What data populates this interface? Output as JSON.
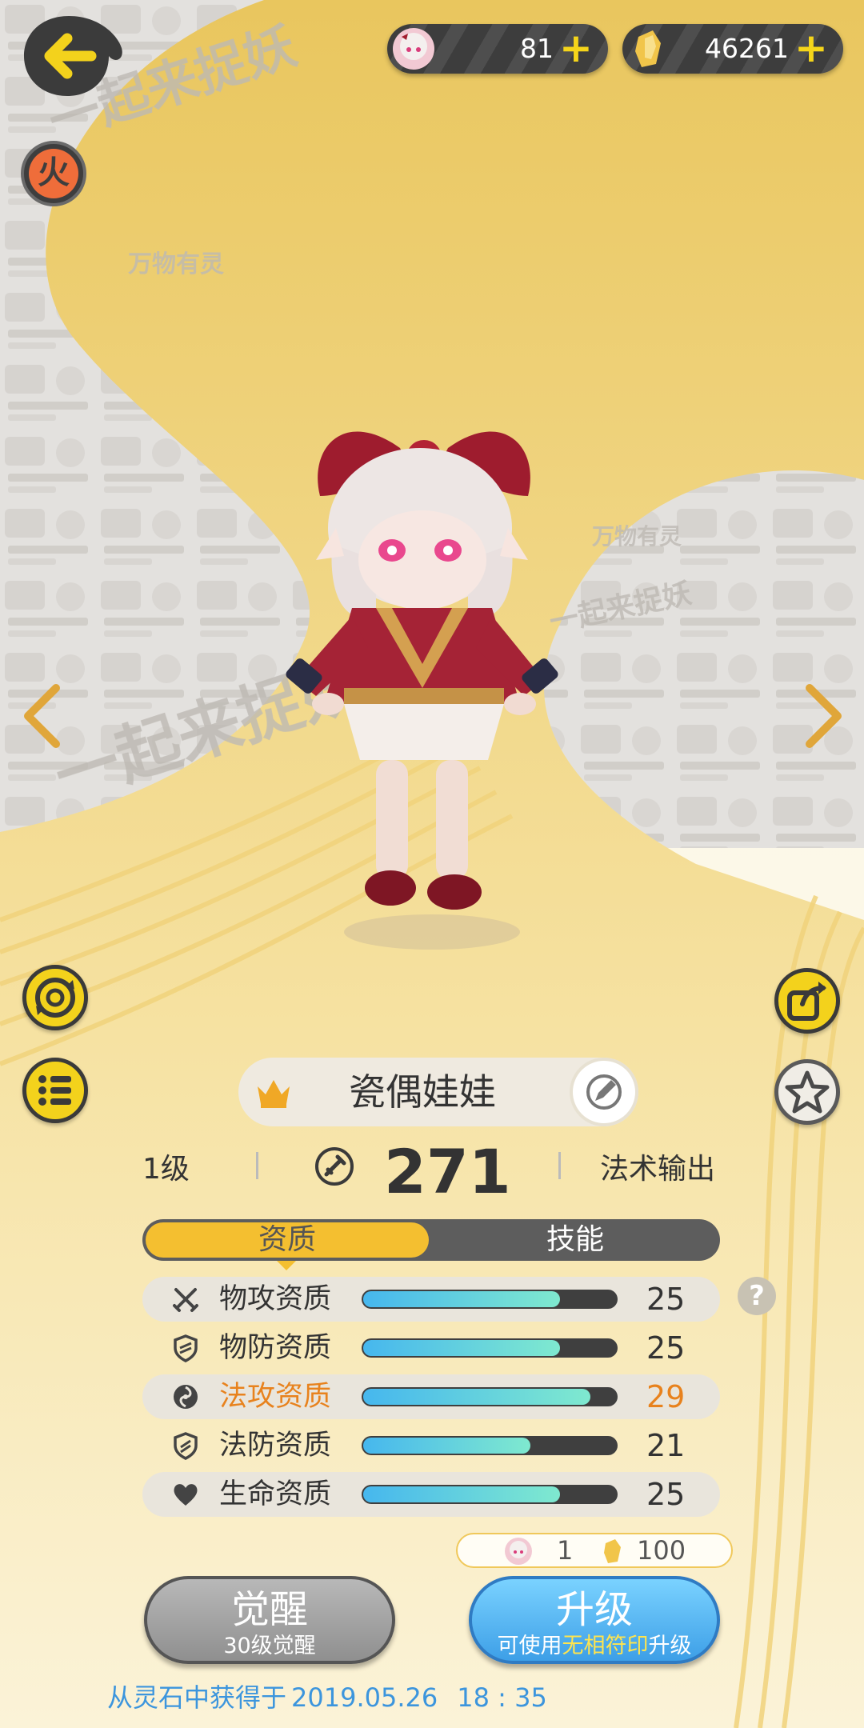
{
  "currency": {
    "doll_count": "81",
    "crystal_count": "46261",
    "plus_symbol": "+"
  },
  "element_badge": "火",
  "background_watermarks": [
    "一起来捉妖",
    "万物有灵",
    "一起来捉妖",
    "一起来捉妖",
    "万物有灵"
  ],
  "pet": {
    "name": "瓷偶娃娃",
    "level": "1级",
    "power": "271",
    "role": "法术输出"
  },
  "tabs": {
    "qualification": "资质",
    "skills": "技能",
    "active": "资质"
  },
  "attributes": [
    {
      "label": "物攻资质",
      "value": "25",
      "fill": 0.78,
      "icon": "crossed-swords-icon",
      "highlight": false
    },
    {
      "label": "物防资质",
      "value": "25",
      "fill": 0.78,
      "icon": "shield-icon",
      "highlight": false
    },
    {
      "label": "法攻资质",
      "value": "29",
      "fill": 0.9,
      "icon": "magic-orb-icon",
      "highlight": true
    },
    {
      "label": "法防资质",
      "value": "21",
      "fill": 0.66,
      "icon": "magic-shield-icon",
      "highlight": false
    },
    {
      "label": "生命资质",
      "value": "25",
      "fill": 0.78,
      "icon": "heart-icon",
      "highlight": false
    }
  ],
  "help_symbol": "?",
  "cost": {
    "doll_amount": "1",
    "crystal_amount": "100"
  },
  "buttons": {
    "awaken": "觉醒",
    "awaken_sub": "30级觉醒",
    "upgrade": "升级",
    "upgrade_sub_prefix": "可使用",
    "upgrade_sub_item": "无相符印",
    "upgrade_sub_suffix": "升级"
  },
  "source": {
    "text": "从灵石中获得于",
    "date": "2019.05.26",
    "time": "18 : 35"
  },
  "colors": {
    "accent_yellow": "#f3d21c",
    "highlight_orange": "#e8821d",
    "source_blue": "#3c95dd",
    "bar_start": "#46b7ee",
    "bar_end": "#7fe9cf"
  }
}
